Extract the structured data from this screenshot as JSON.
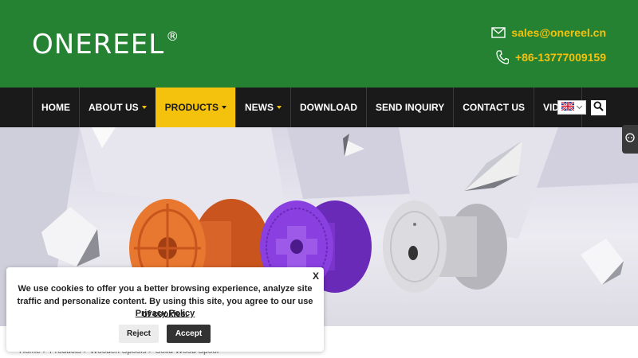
{
  "header": {
    "logo_text": "ONEREEL",
    "logo_mark": "®",
    "email": "sales@onereel.cn",
    "phone": "+86-13777009159",
    "email_icon": "envelope-icon",
    "phone_icon": "phone-icon"
  },
  "nav": {
    "items": [
      {
        "label": "HOME",
        "dropdown": false
      },
      {
        "label": "ABOUT US",
        "dropdown": true
      },
      {
        "label": "PRODUCTS",
        "dropdown": true,
        "active": true
      },
      {
        "label": "NEWS",
        "dropdown": true
      },
      {
        "label": "DOWNLOAD",
        "dropdown": false
      },
      {
        "label": "SEND INQUIRY",
        "dropdown": false
      },
      {
        "label": "CONTACT US",
        "dropdown": false
      },
      {
        "label": "VIDEO",
        "dropdown": false
      }
    ],
    "language_icon": "uk-flag-icon",
    "search_icon": "search-icon"
  },
  "colors": {
    "header_bg": "#268233",
    "accent": "#f4c20d",
    "nav_bg": "#1a1a1a"
  },
  "breadcrumb": "Home > Products > Wooden Spools > Solid Wood Spool",
  "cookie": {
    "close_label": "X",
    "message": "We use cookies to offer you a better browsing experience, analyze site traffic and personalize content. By using this site, you agree to our use of cookies.",
    "policy_link": "Privacy Policy",
    "reject_label": "Reject",
    "accept_label": "Accept"
  }
}
